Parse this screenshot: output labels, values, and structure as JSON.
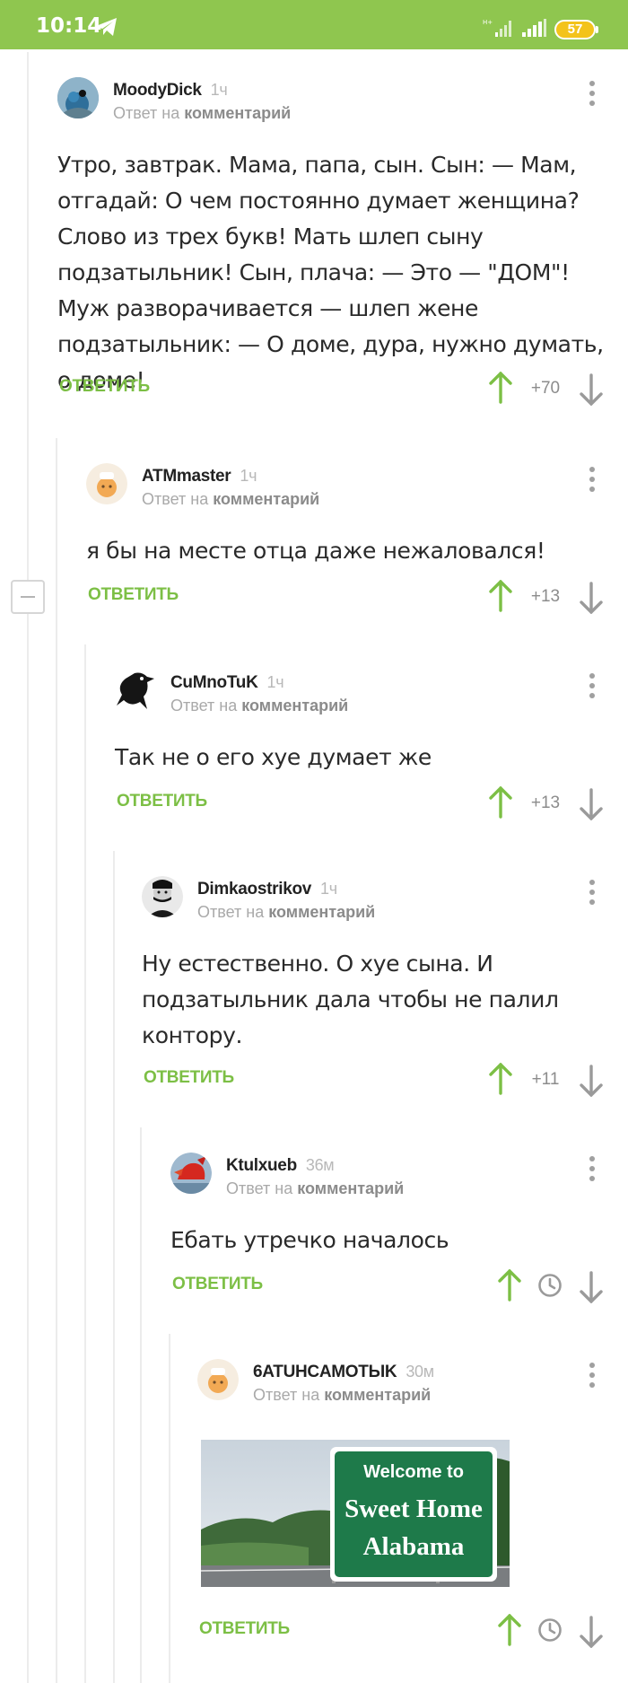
{
  "status": {
    "time": "10:14",
    "battery": "57"
  },
  "comments": [
    {
      "author": "MoodyDick",
      "time": "1ч",
      "reply_prefix": "Ответ на",
      "reply_target": "комментарий",
      "text": "Утро, завтрак. Мама, папа, сын. Сын: — Мам, отгадай: О чем постоянно думает женщина? Слово из трех букв! Мать шлеп сыну подзатыльник! Сын, плача: — Это — \"ДОМ\"! Муж разворачивается — шлеп жене подзатыльник: — О доме, дура, нужно думать, о доме!",
      "reply_label": "ОТВЕТИТЬ",
      "score": "+70"
    },
    {
      "author": "ATMmaster",
      "time": "1ч",
      "reply_prefix": "Ответ на",
      "reply_target": "комментарий",
      "text": "я бы на месте отца даже нежаловался!",
      "reply_label": "ОТВЕТИТЬ",
      "score": "+13"
    },
    {
      "author": "CuMnoTuK",
      "time": "1ч",
      "reply_prefix": "Ответ на",
      "reply_target": "комментарий",
      "text": "Так не о его хуе думает же",
      "reply_label": "ОТВЕТИТЬ",
      "score": "+13"
    },
    {
      "author": "Dimkaostrikov",
      "time": "1ч",
      "reply_prefix": "Ответ на",
      "reply_target": "комментарий",
      "text": "Ну естественно. О хуе сына. И подзатыльник дала чтобы не палил контору.",
      "reply_label": "ОТВЕТИТЬ",
      "score": "+11"
    },
    {
      "author": "Ktulxueb",
      "time": "36м",
      "reply_prefix": "Ответ на",
      "reply_target": "комментарий",
      "text": "Ебать утречко началось",
      "reply_label": "ОТВЕТИТЬ",
      "score": ""
    },
    {
      "author": "6ATUHCAMOTЫK",
      "time": "30м",
      "reply_prefix": "Ответ на",
      "reply_target": "комментарий",
      "text": "",
      "reply_label": "ОТВЕТИТЬ",
      "score": ""
    }
  ],
  "sign": {
    "line1": "Welcome to",
    "line2": "Sweet Home",
    "line3": "Alabama"
  },
  "colors": {
    "accent": "#8fc64f",
    "reply": "#7cbf45"
  }
}
